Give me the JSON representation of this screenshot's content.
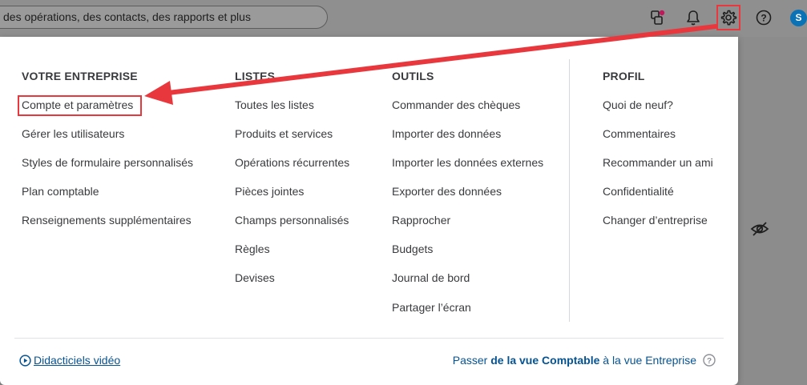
{
  "search": {
    "text": "des opérations, des contacts, des rapports et plus"
  },
  "topbar": {
    "avatar_letter": "S"
  },
  "menu": {
    "columns": [
      {
        "heading": "VOTRE ENTREPRISE",
        "items": [
          "Compte et paramètres",
          "Gérer les utilisateurs",
          "Styles de formulaire personnalisés",
          "Plan comptable",
          "Renseignements supplémentaires"
        ]
      },
      {
        "heading": "LISTES",
        "items": [
          "Toutes les listes",
          "Produits et services",
          "Opérations récurrentes",
          "Pièces jointes",
          "Champs personnalisés",
          "Règles",
          "Devises"
        ]
      },
      {
        "heading": "OUTILS",
        "items": [
          "Commander des chèques",
          "Importer des données",
          "Importer les données externes",
          "Exporter des données",
          "Rapprocher",
          "Budgets",
          "Journal de bord",
          "Partager l’écran"
        ]
      },
      {
        "heading": "PROFIL",
        "items": [
          "Quoi de neuf?",
          "Commentaires",
          "Recommander un ami",
          "Confidentialité",
          "Changer d’entreprise"
        ]
      }
    ]
  },
  "footer": {
    "tutorials": "Didacticiels vidéo",
    "switch_prefix": "Passer ",
    "switch_bold": "de la vue Comptable",
    "switch_suffix": " à la vue Entreprise"
  },
  "colors": {
    "highlight": "#e8383d",
    "link": "#055393",
    "avatar": "#0a72b5"
  }
}
